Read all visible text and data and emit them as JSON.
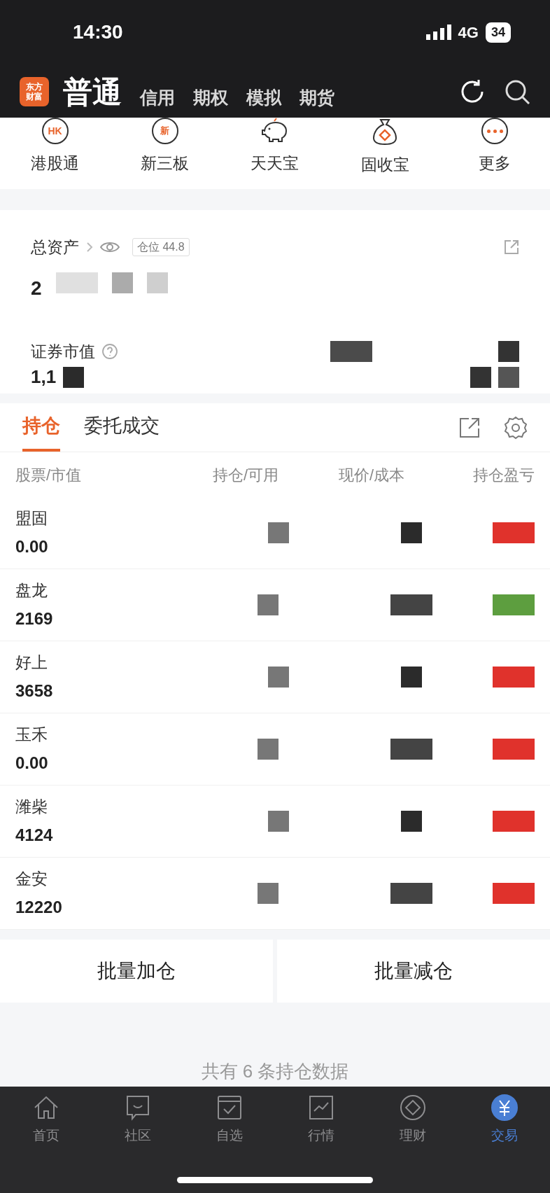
{
  "status_bar": {
    "time": "14:30",
    "network": "4G",
    "battery": "34"
  },
  "header": {
    "logo": "东方财富",
    "tabs": [
      {
        "label": "普通",
        "selected": true
      },
      {
        "label": "信用",
        "selected": false
      },
      {
        "label": "期权",
        "selected": false
      },
      {
        "label": "模拟",
        "selected": false
      },
      {
        "label": "期货",
        "selected": false
      }
    ]
  },
  "shortcuts": [
    {
      "label": "港股通",
      "kind": "hk",
      "badge": "HK"
    },
    {
      "label": "新三板",
      "kind": "new",
      "badge": "新"
    },
    {
      "label": "天天宝",
      "kind": "piggy"
    },
    {
      "label": "固收宝",
      "kind": "bag"
    },
    {
      "label": "更多",
      "kind": "more"
    }
  ],
  "assets": {
    "total_label": "总资产",
    "position_tag": "仓位 44.8",
    "total_value": "2",
    "market_label": "证券市值",
    "market_value": "1,1"
  },
  "holdings_tabs": [
    {
      "label": "持仓",
      "selected": true
    },
    {
      "label": "委托成交",
      "selected": false
    }
  ],
  "columns": [
    "股票/市值",
    "持仓/可用",
    "现价/成本",
    "持仓盈亏"
  ],
  "rows": [
    {
      "name": "盟固",
      "value": "0.00",
      "color": "#e0322c"
    },
    {
      "name": "盘龙",
      "value": "2169",
      "color": "#5d9e3f"
    },
    {
      "name": "好上",
      "value": "3658",
      "color": "#e0322c"
    },
    {
      "name": "玉禾",
      "value": "0.00",
      "color": "#e0322c"
    },
    {
      "name": "潍柴",
      "value": "4124",
      "color": "#e0322c"
    },
    {
      "name": "金安",
      "value": "12220",
      "color": "#e0322c"
    }
  ],
  "actions": [
    "批量加仓",
    "批量减仓"
  ],
  "footer_note": "共有 6 条持仓数据",
  "nav": [
    {
      "label": "首页",
      "kind": "home",
      "selected": false
    },
    {
      "label": "社区",
      "kind": "chat",
      "selected": false
    },
    {
      "label": "自选",
      "kind": "check",
      "selected": false
    },
    {
      "label": "行情",
      "kind": "chart",
      "selected": false
    },
    {
      "label": "理财",
      "kind": "diamond",
      "selected": false
    },
    {
      "label": "交易",
      "kind": "yuan",
      "selected": true
    }
  ]
}
